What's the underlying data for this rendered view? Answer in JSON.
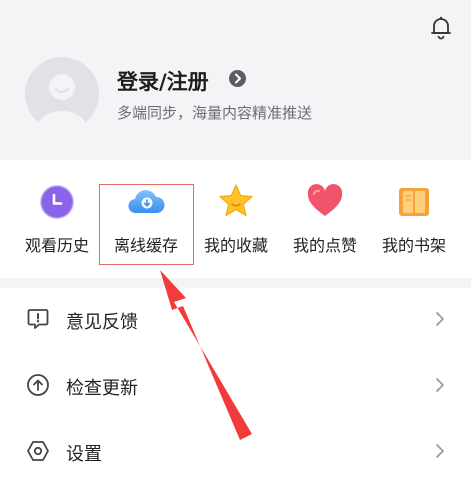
{
  "header": {
    "login_label": "登录/注册",
    "subtitle": "多端同步，海量内容精准推送"
  },
  "icons": {
    "bell": "bell-icon",
    "avatar": "avatar-icon",
    "login_chevron": "chevron-right-circle-icon"
  },
  "quick_actions": [
    {
      "label": "观看历史",
      "icon": "history-clock-icon",
      "color": "#8a63e8"
    },
    {
      "label": "离线缓存",
      "icon": "cloud-download-icon",
      "color": "#3a8df0"
    },
    {
      "label": "我的收藏",
      "icon": "star-icon",
      "color": "#ffb620"
    },
    {
      "label": "我的点赞",
      "icon": "heart-icon",
      "color": "#f0536b"
    },
    {
      "label": "我的书架",
      "icon": "book-icon",
      "color": "#f6a23a"
    }
  ],
  "menu": [
    {
      "label": "意见反馈",
      "icon": "feedback-icon"
    },
    {
      "label": "检查更新",
      "icon": "update-arrow-icon"
    },
    {
      "label": "设置",
      "icon": "settings-hexagon-icon"
    }
  ],
  "annotation": {
    "highlight_color": "#e46a6a",
    "arrow_color": "#f23b3b"
  }
}
